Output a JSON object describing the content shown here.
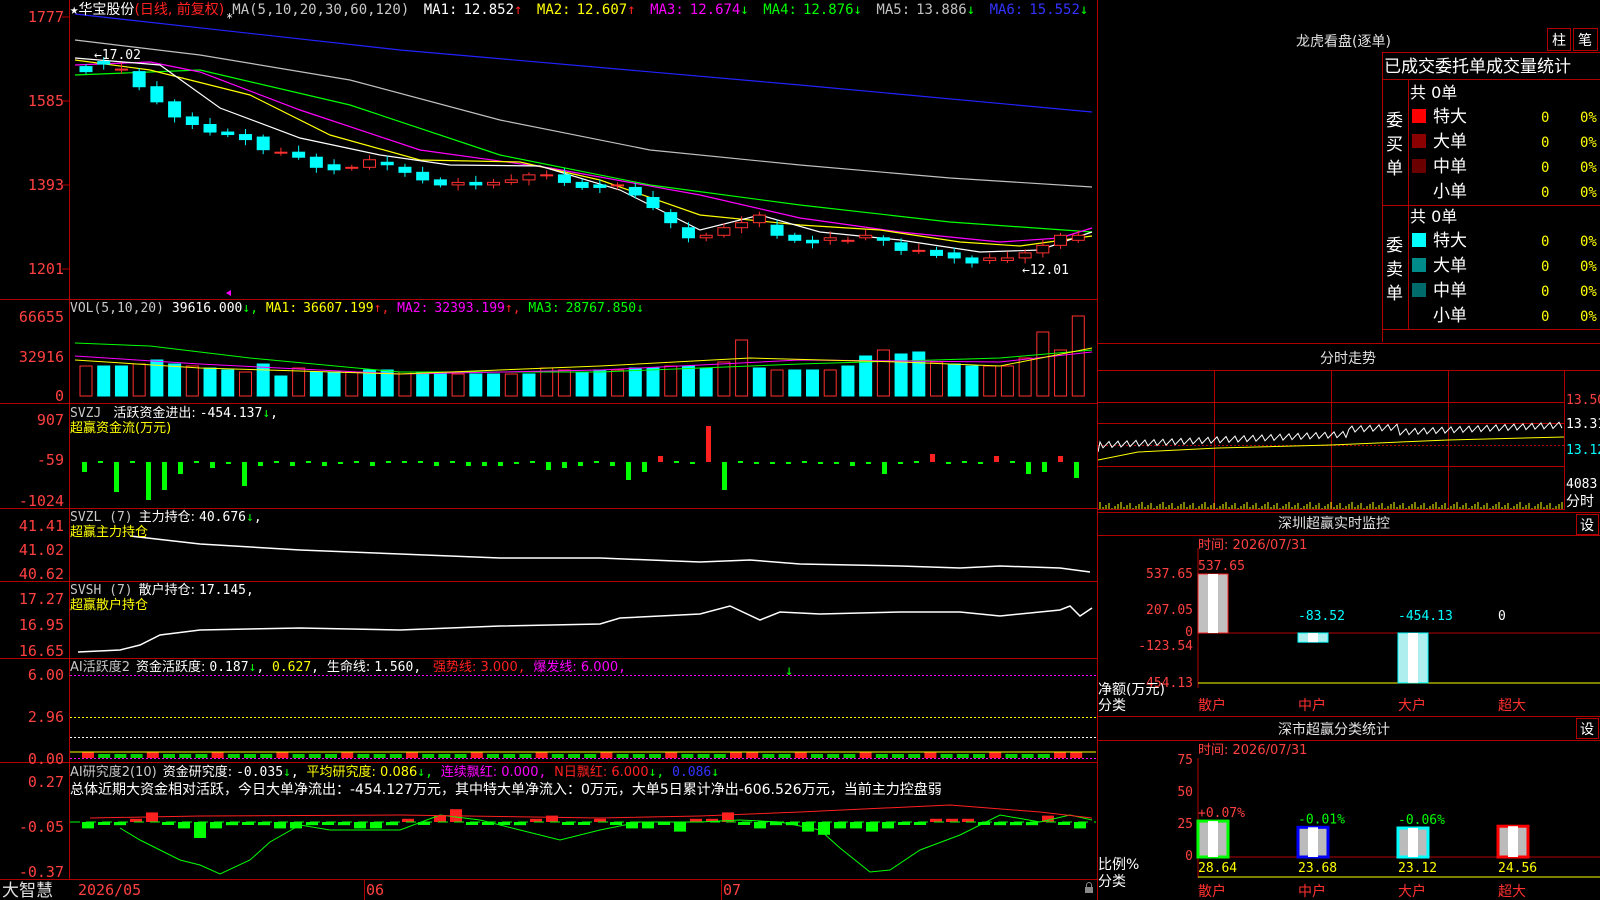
{
  "stock": {
    "name": "华宝股份",
    "mode": "(日线, 前复权)",
    "star": "★",
    "ma_header": "MA(5,10,20,30,60,120)",
    "ma_values": [
      {
        "label": "MA1:",
        "value": "12.852",
        "arrow": "↑",
        "color": "#ffffff"
      },
      {
        "label": "MA2:",
        "value": "12.607",
        "arrow": "↑",
        "color": "#ffff00"
      },
      {
        "label": "MA3:",
        "value": "12.674",
        "arrow": "↓",
        "color": "#ff00ff"
      },
      {
        "label": "MA4:",
        "value": "12.876",
        "arrow": "↓",
        "color": "#00ff00"
      },
      {
        "label": "MA5:",
        "value": "13.886",
        "arrow": "↓",
        "color": "#c0c0c0"
      },
      {
        "label": "MA6:",
        "value": "15.552",
        "arrow": "↓",
        "color": "#3333ff"
      }
    ],
    "price_axis": [
      "1777",
      "1585",
      "1393",
      "1201"
    ],
    "high_label": "←17.02",
    "low_label": "←12.01"
  },
  "vol": {
    "header": "VOL(5,10,20)",
    "value": "39616.000",
    "ma": [
      {
        "label": "MA1:",
        "value": "36607.199",
        "arrow": "↑",
        "color": "#ffff00"
      },
      {
        "label": "MA2:",
        "value": "32393.199",
        "arrow": "↑",
        "color": "#ff00ff"
      },
      {
        "label": "MA3:",
        "value": "28767.850",
        "arrow": "↓",
        "color": "#00ff00"
      }
    ],
    "axis": [
      "66655",
      "32916",
      "0"
    ]
  },
  "svzj": {
    "header": "SVZJ",
    "label": "活跃资金进出:",
    "value": "-454.137",
    "arrow": "↓",
    "sub": "超赢资金流(万元)",
    "axis": [
      "907",
      "-59",
      "-1024"
    ]
  },
  "svzl": {
    "header": "SVZL (7)",
    "label": "主力持仓:",
    "value": "40.676",
    "arrow": "↓",
    "sub": "超赢主力持仓",
    "axis": [
      "41.41",
      "41.02",
      "40.62"
    ]
  },
  "svsh": {
    "header": "SVSH (7)",
    "label": "散户持仓:",
    "value": "17.145",
    "arrow": "",
    "sub": "超赢散户持仓",
    "axis": [
      "17.27",
      "16.95",
      "16.65"
    ]
  },
  "ai1": {
    "header": "AI活跃度2",
    "label": "资金活跃度:",
    "value": "0.187",
    "arrow": "↓",
    "v2": "0.627",
    "life_label": "生命线:",
    "life": "1.560",
    "strong": "强势线: 3.000",
    "burst": "爆发线: 6.000",
    "axis": [
      "6.00",
      "2.96",
      "0.00"
    ]
  },
  "ai2": {
    "header": "AI研究度2(10)",
    "label": "资金研究度:",
    "value": "-0.035",
    "arrow": "↓",
    "avg": "平均研究度: 0.086",
    "cont": "连续飘红: 0.000",
    "nday": "N日飘红: 6.000",
    "last": "0.086",
    "summary": "总体近期大资金相对活跃，今日大单净流出：-454.127万元，其中特大单净流入：0万元，大单5日累计净出-606.526万元，当前主力控盘弱",
    "axis": [
      "0.27",
      "-0.05",
      "-0.37"
    ]
  },
  "bottom": {
    "brand": "大智慧",
    "dates": [
      "2026/05",
      "06",
      "07"
    ]
  },
  "dragon": {
    "title": "龙虎看盘(逐单)",
    "btn1": "柱",
    "btn2": "笔",
    "tabs": "已成交委托单成交量统计",
    "buy_label": "委买单",
    "sell_label": "委卖单",
    "buy_total": "共 0单",
    "sell_total": "共 0单",
    "buy_rows": [
      {
        "name": "特大",
        "count": "0",
        "pct": "0%",
        "color": "#ff0000"
      },
      {
        "name": "大单",
        "count": "0",
        "pct": "0%",
        "color": "#8b0000"
      },
      {
        "name": "中单",
        "count": "0",
        "pct": "0%",
        "color": "#6a0000"
      },
      {
        "name": "小单",
        "count": "0",
        "pct": "0%",
        "color": ""
      }
    ],
    "sell_rows": [
      {
        "name": "特大",
        "count": "0",
        "pct": "0%",
        "color": "#00ffff"
      },
      {
        "name": "大单",
        "count": "0",
        "pct": "0%",
        "color": "#008b8b"
      },
      {
        "name": "中单",
        "count": "0",
        "pct": "0%",
        "color": "#006b6b"
      },
      {
        "name": "小单",
        "count": "0",
        "pct": "0%",
        "color": ""
      }
    ]
  },
  "intraday": {
    "title": "分时走势",
    "axis": [
      "13.50",
      "13.31",
      "13.12"
    ],
    "vol_label": "4083",
    "time_label": "分时"
  },
  "sz_monitor": {
    "title": "深圳超赢实时监控",
    "btn": "设",
    "time": "时间: 2026/07/31",
    "axis": [
      "537.65",
      "207.05",
      "0",
      "-123.54",
      "-454.13"
    ],
    "unit": "净额(万元)",
    "cat_label": "分类",
    "bars": [
      {
        "cat": "散户",
        "label": "537.65",
        "value": 537.65
      },
      {
        "cat": "中户",
        "label": "-83.52",
        "value": -83.52
      },
      {
        "cat": "大户",
        "label": "-454.13",
        "value": -454.13
      },
      {
        "cat": "超大",
        "label": "0",
        "value": 0
      }
    ]
  },
  "sz_class": {
    "title": "深市超赢分类统计",
    "btn": "设",
    "time": "时间: 2026/07/31",
    "axis": [
      "75",
      "50",
      "25",
      "0"
    ],
    "unit": "比例%",
    "cat_label": "分类",
    "bars": [
      {
        "cat": "散户",
        "delta": "+0.07%",
        "value": "28.64",
        "num": 28.64,
        "color": "#00ff00",
        "dcolor": "#ff4040"
      },
      {
        "cat": "中户",
        "delta": "-0.01%",
        "value": "23.68",
        "num": 23.68,
        "color": "#0000ff",
        "dcolor": "#00ff00"
      },
      {
        "cat": "大户",
        "delta": "-0.06%",
        "value": "23.12",
        "num": 23.12,
        "color": "#00ffff",
        "dcolor": "#00ff00"
      },
      {
        "cat": "超大",
        "delta": "",
        "value": "24.56",
        "num": 24.56,
        "color": "#ff0000",
        "dcolor": "#ff4040"
      }
    ]
  }
}
